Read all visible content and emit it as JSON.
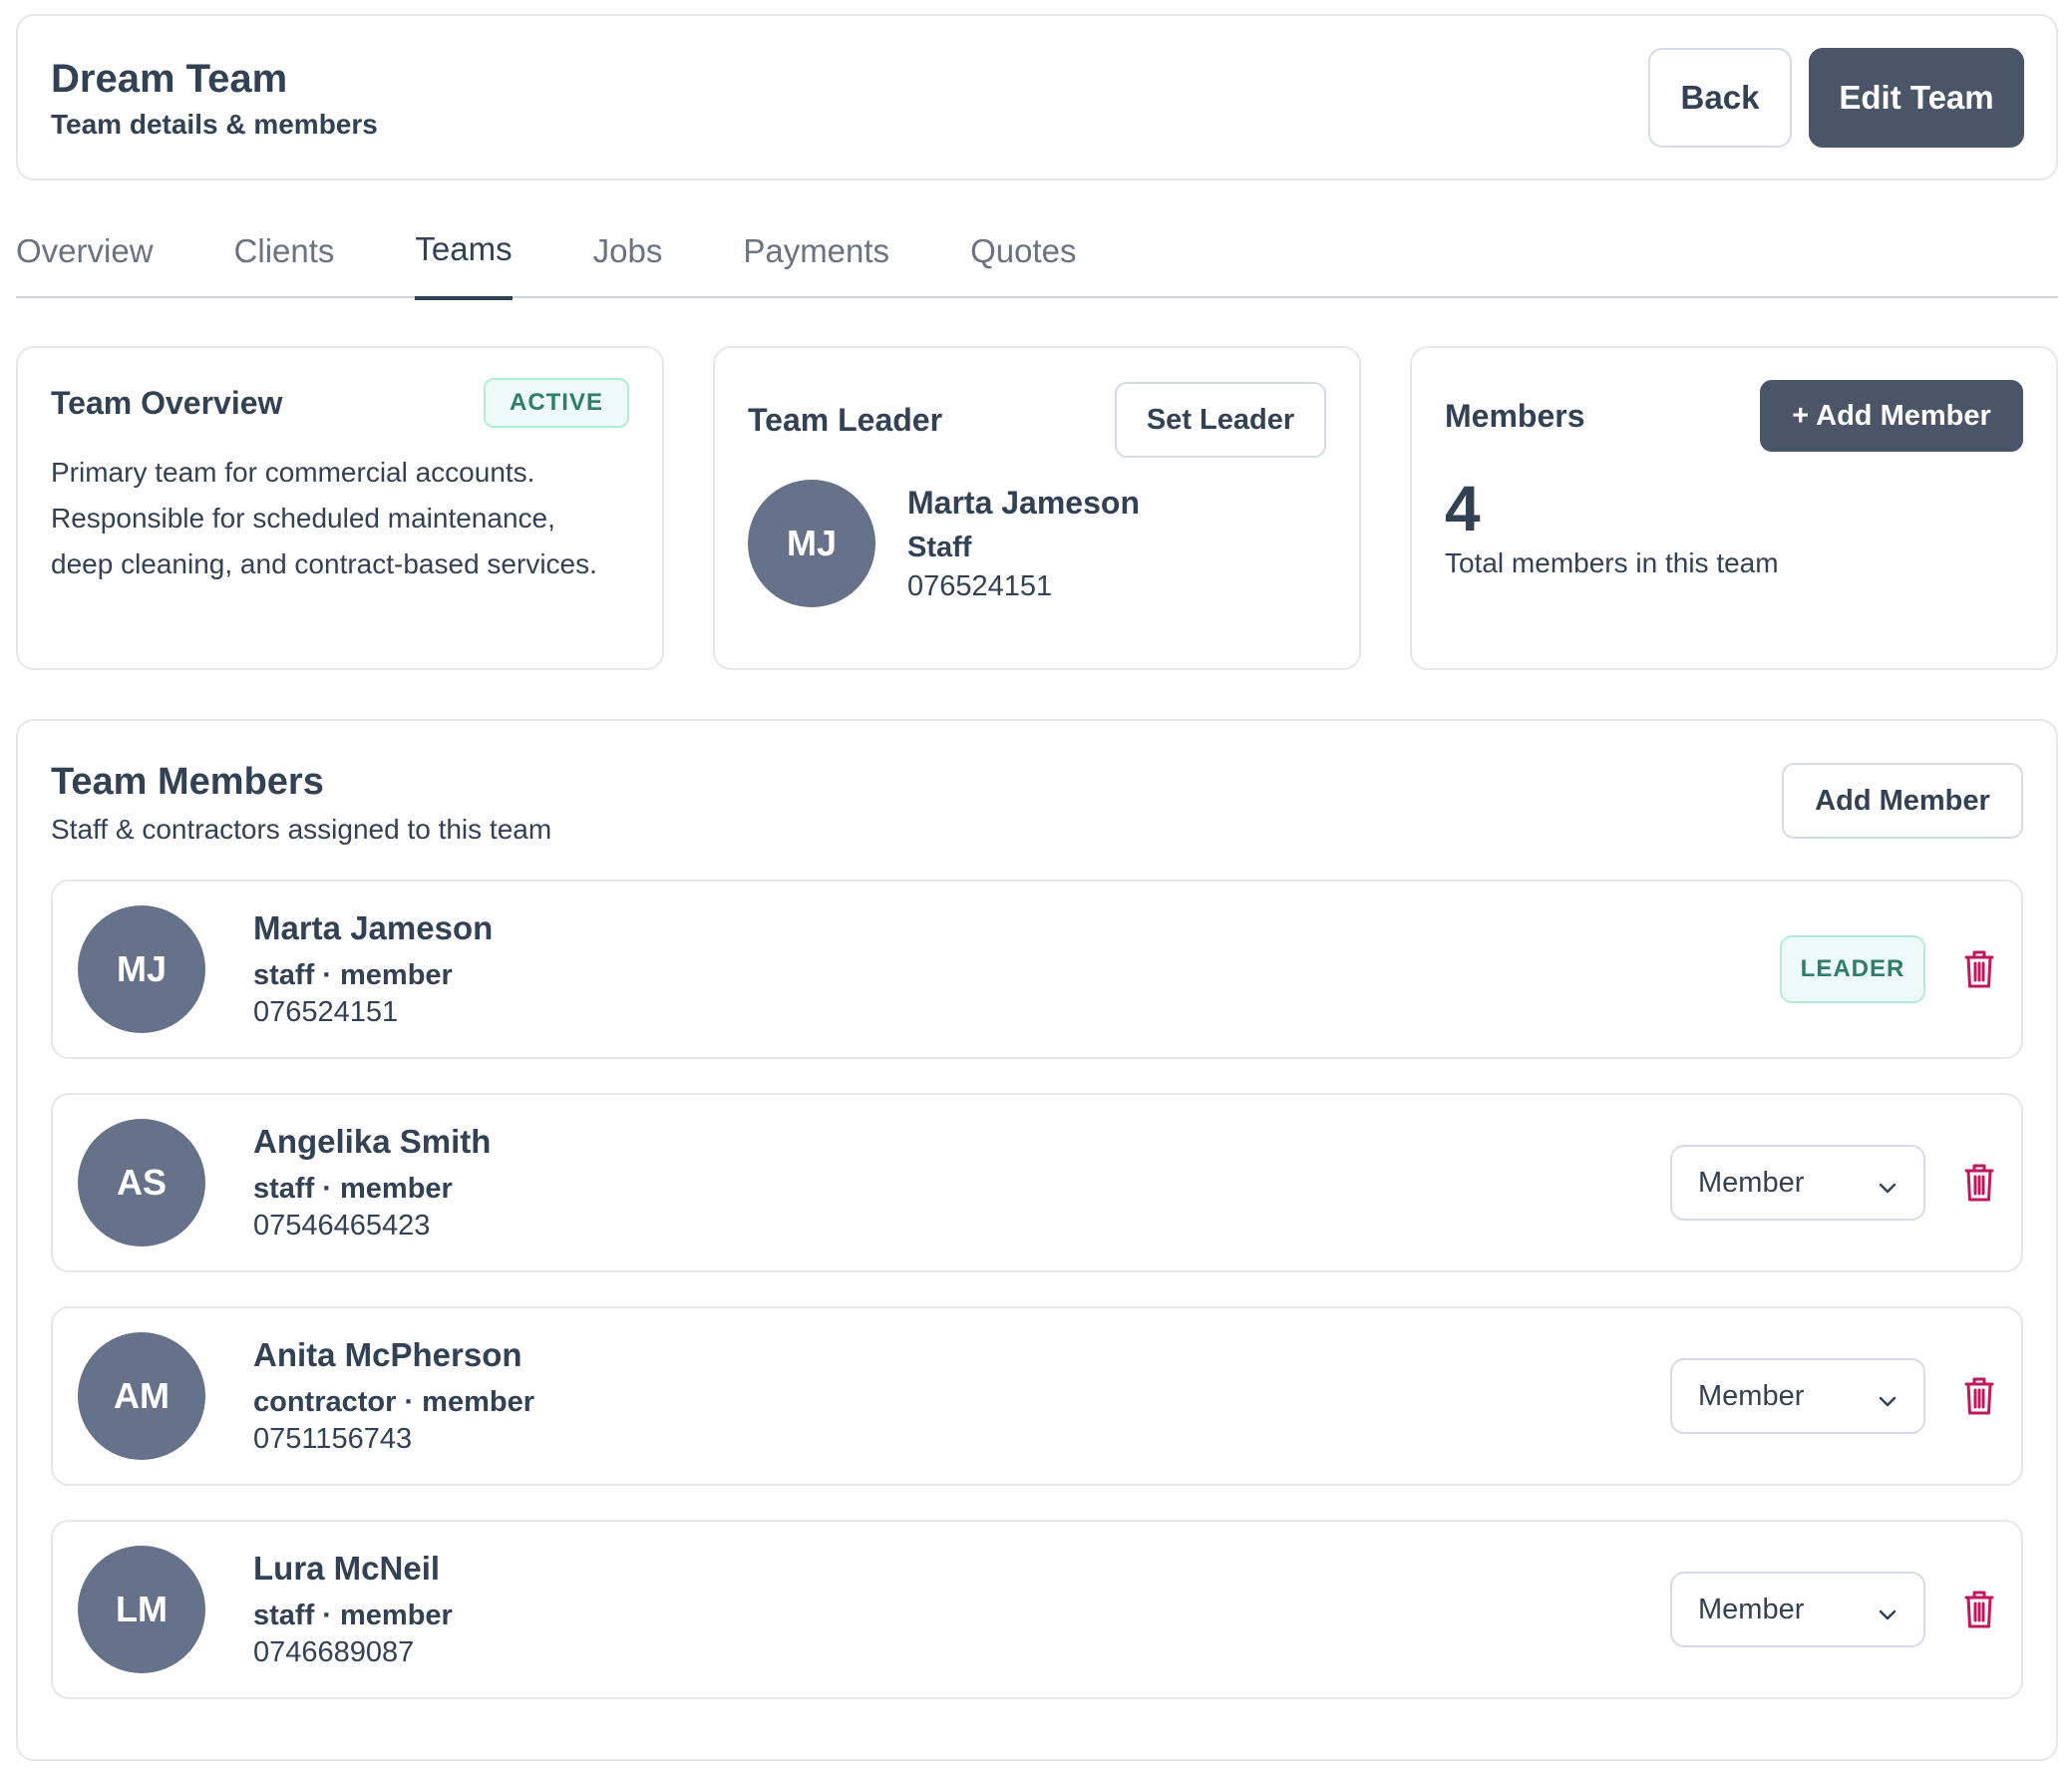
{
  "header": {
    "title": "Dream Team",
    "subtitle": "Team details & members",
    "back_label": "Back",
    "edit_label": "Edit Team"
  },
  "tabs": [
    {
      "label": "Overview",
      "active": false
    },
    {
      "label": "Clients",
      "active": false
    },
    {
      "label": "Teams",
      "active": true
    },
    {
      "label": "Jobs",
      "active": false
    },
    {
      "label": "Payments",
      "active": false
    },
    {
      "label": "Quotes",
      "active": false
    }
  ],
  "overview_card": {
    "title": "Team Overview",
    "status": "ACTIVE",
    "description": "Primary team for commercial accounts. Responsible for scheduled maintenance, deep cleaning, and contract-based services."
  },
  "leader_card": {
    "title": "Team Leader",
    "set_leader_label": "Set Leader",
    "initials": "MJ",
    "name": "Marta Jameson",
    "role": "Staff",
    "phone": "076524151"
  },
  "members_card": {
    "title": "Members",
    "add_label": "+ Add Member",
    "count": "4",
    "caption": "Total members in this team"
  },
  "team_members": {
    "title": "Team Members",
    "subtitle": "Staff & contractors assigned to this team",
    "add_label": "Add Member",
    "members": [
      {
        "initials": "MJ",
        "name": "Marta Jameson",
        "meta": "staff · member",
        "phone": "076524151",
        "badge": "LEADER",
        "role": ""
      },
      {
        "initials": "AS",
        "name": "Angelika Smith",
        "meta": "staff · member",
        "phone": "07546465423",
        "badge": "",
        "role": "Member"
      },
      {
        "initials": "AM",
        "name": "Anita McPherson",
        "meta": "contractor · member",
        "phone": "0751156743",
        "badge": "",
        "role": "Member"
      },
      {
        "initials": "LM",
        "name": "Lura McNeil",
        "meta": "staff · member",
        "phone": "0746689087",
        "badge": "",
        "role": "Member"
      }
    ]
  },
  "colors": {
    "dark_button": "#4b5568",
    "avatar": "#66728a",
    "badge_text": "#2f7d6b",
    "delete_icon": "#c0185f"
  },
  "icons": {
    "delete": "trash-icon",
    "select": "chevron-down-icon"
  }
}
